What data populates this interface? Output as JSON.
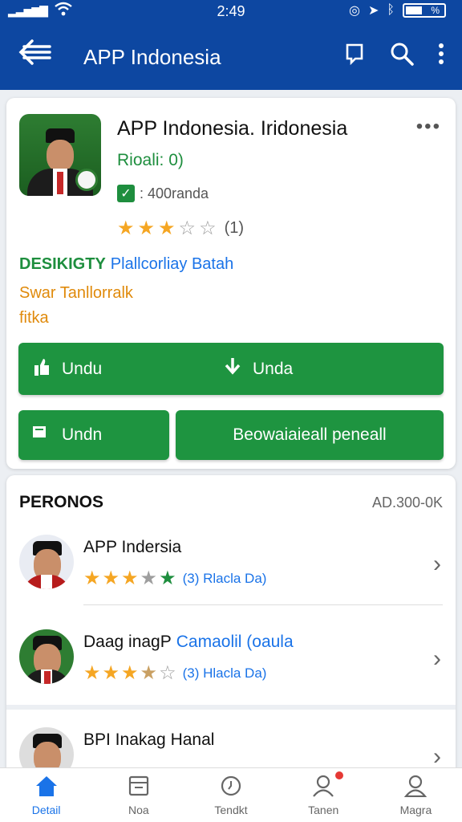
{
  "status": {
    "time": "2:49",
    "battery_label": "%"
  },
  "appbar": {
    "title": "APP Indonesia"
  },
  "app_card": {
    "title": "APP Indonesia. Iridonesia",
    "subtitle": "Rioali: 0)",
    "verified_text": ": 400randa",
    "rating_count": "(1)",
    "tag_green": "DESIKIGTY",
    "tag_blue": "Plallcorliay Batah",
    "orange_line1": "Swar Tanllorralk",
    "orange_line2": "fitka",
    "btn_like": "Undu",
    "btn_download": "Unda",
    "btn_small": "Undn",
    "btn_large": "Beowaiaieall peneall"
  },
  "persons": {
    "title": "PERONOS",
    "count": "AD.300-0K",
    "items": [
      {
        "name": "APP Indersia",
        "name_extra": "",
        "rating_label": "(3) Rlacla Da)"
      },
      {
        "name": "Daag inagP",
        "name_extra": "Camaolil (oaula",
        "rating_label": "(3) Hlacla Da)"
      },
      {
        "name": "BPI Inakag Hanal",
        "name_extra": "",
        "rating_label": ""
      }
    ]
  },
  "nav": [
    {
      "label": "Detail",
      "icon": "home-icon"
    },
    {
      "label": "Noa",
      "icon": "calendar-icon"
    },
    {
      "label": "Tendkt",
      "icon": "clock-icon"
    },
    {
      "label": "Tanen",
      "icon": "user-icon"
    },
    {
      "label": "Magra",
      "icon": "person-icon"
    }
  ],
  "colors": {
    "primary": "#0d47a1",
    "green": "#1e9440",
    "star": "#f5a623",
    "link": "#1a73e8"
  }
}
